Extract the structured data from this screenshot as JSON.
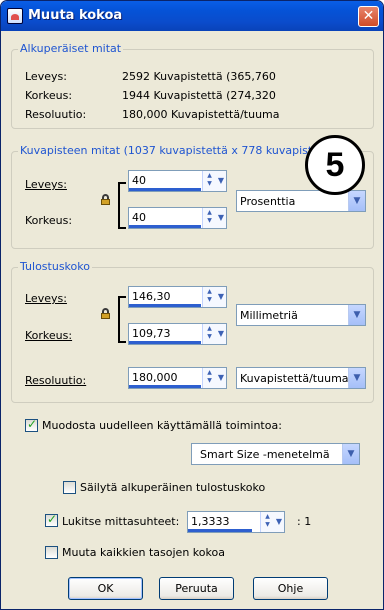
{
  "window": {
    "title": "Muuta kokoa",
    "close_icon": "close-icon"
  },
  "original": {
    "legend": "Alkuperäiset mitat",
    "rows": [
      {
        "label": "Leveys:",
        "value": "2592 Kuvapistettä (365,760"
      },
      {
        "label": "Korkeus:",
        "value": "1944 Kuvapistettä (274,320"
      },
      {
        "label": "Resoluutio:",
        "value": "180,000 Kuvapistettä/tuuma"
      }
    ]
  },
  "pixel": {
    "legend": "Kuvapisteen mitat (1037 kuvapistettä x 778 kuvapiste",
    "width_label": "Leveys:",
    "width_value": "40",
    "height_label": "Korkeus:",
    "height_value": "40",
    "unit": "Prosenttia"
  },
  "print": {
    "legend": "Tulostuskoko",
    "width_label": "Leveys:",
    "width_value": "146,30",
    "height_label": "Korkeus:",
    "height_value": "109,73",
    "unit": "Millimetriä",
    "res_label": "Resoluutio:",
    "res_value": "180,000",
    "res_unit": "Kuvapistettä/tuuma"
  },
  "options": {
    "resample_label": "Muodosta uudelleen käyttämällä toimintoa:",
    "resample_checked": true,
    "method": "Smart Size -menetelmä",
    "keep_print_label": "Säilytä alkuperäinen tulostuskoko",
    "keep_print_checked": false,
    "lock_ratio_label": "Lukitse mittasuhteet:",
    "lock_ratio_checked": true,
    "ratio_value": "1,3333",
    "ratio_suffix": ": 1",
    "all_layers_label": "Muuta kaikkien tasojen kokoa",
    "all_layers_checked": false
  },
  "buttons": {
    "ok": "OK",
    "cancel": "Peruuta",
    "help": "Ohje"
  },
  "badge": "5"
}
